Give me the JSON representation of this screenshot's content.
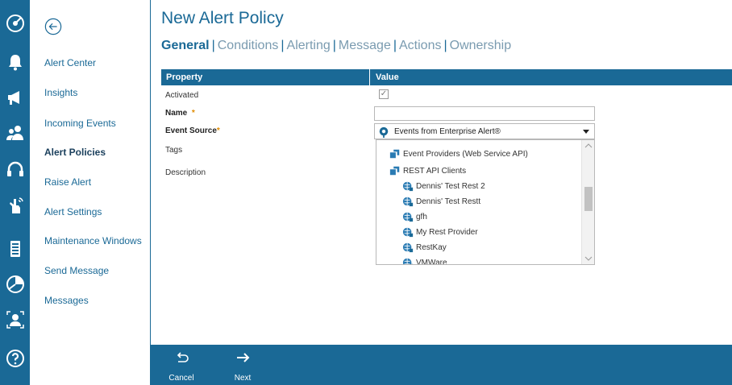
{
  "window": {
    "title": "New Alert Policy"
  },
  "rail": {
    "icons": [
      "satellite-dish-icon",
      "bell-icon",
      "megaphone-icon",
      "users-icon",
      "headset-icon",
      "hand-signal-icon",
      "server-icon",
      "pie-chart-icon",
      "user-focus-icon",
      "help-icon"
    ]
  },
  "nav": {
    "back_icon": "arrow-left-circle-icon",
    "items": [
      {
        "label": "Alert Center"
      },
      {
        "label": "Insights"
      },
      {
        "label": "Incoming Events"
      },
      {
        "label": "Alert Policies",
        "active": true
      },
      {
        "label": "Raise Alert"
      },
      {
        "label": "Alert Settings"
      },
      {
        "label": "Maintenance Windows"
      },
      {
        "label": "Send Message"
      },
      {
        "label": "Messages"
      }
    ]
  },
  "tabs": [
    {
      "label": "General",
      "active": true
    },
    {
      "label": "Conditions"
    },
    {
      "label": "Alerting"
    },
    {
      "label": "Message"
    },
    {
      "label": "Actions"
    },
    {
      "label": "Ownership"
    }
  ],
  "table": {
    "header_property": "Property",
    "header_value": "Value",
    "rows": {
      "activated": "Activated",
      "name": "Name",
      "event_source": "Event Source",
      "tags": "Tags",
      "description": "Description"
    },
    "required_mark": "*"
  },
  "form": {
    "activated_checked": true,
    "checkmark": "✓",
    "name_value": "",
    "event_source_selected": "Events from Enterprise Alert®"
  },
  "dropdown": {
    "items": [
      {
        "label": "Event Providers (Web Service API)",
        "icon": "provider-icon",
        "level": 1
      },
      {
        "label": "REST API Clients",
        "icon": "provider-icon",
        "level": 1
      },
      {
        "label": "Dennis' Test Rest 2",
        "icon": "globe-icon",
        "level": 2
      },
      {
        "label": "Dennis' Test Restt",
        "icon": "globe-icon",
        "level": 2
      },
      {
        "label": "gfh",
        "icon": "globe-icon",
        "level": 2
      },
      {
        "label": "My Rest Provider",
        "icon": "globe-icon",
        "level": 2
      },
      {
        "label": "RestKay",
        "icon": "globe-icon",
        "level": 2
      },
      {
        "label": "VMWare",
        "icon": "globe-icon",
        "level": 2
      }
    ]
  },
  "bottom_bar": {
    "cancel_label": "Cancel",
    "next_label": "Next"
  },
  "colors": {
    "brand": "#1a6996",
    "required": "#e08b00"
  }
}
